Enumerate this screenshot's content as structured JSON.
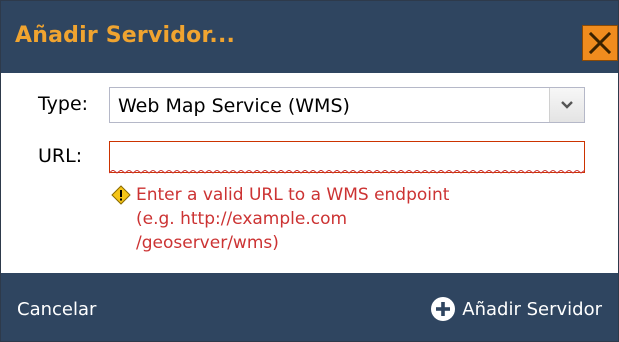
{
  "dialog": {
    "title": "Añadir Servidor...",
    "close_icon": "close-icon",
    "accent_color": "#f0a430",
    "header_color": "#2f4560"
  },
  "form": {
    "type_label": "Type:",
    "type_value": "Web Map Service (WMS)",
    "url_label": "URL:",
    "url_value": "",
    "error_icon": "warning-icon",
    "error_text": "Enter a valid URL to a WMS endpoint\n(e.g. http://example.com\n/geoserver/wms)",
    "error_color": "#cc3333"
  },
  "footer": {
    "cancel_label": "Cancelar",
    "add_icon": "plus-circle-icon",
    "add_label": "Añadir Servidor"
  }
}
